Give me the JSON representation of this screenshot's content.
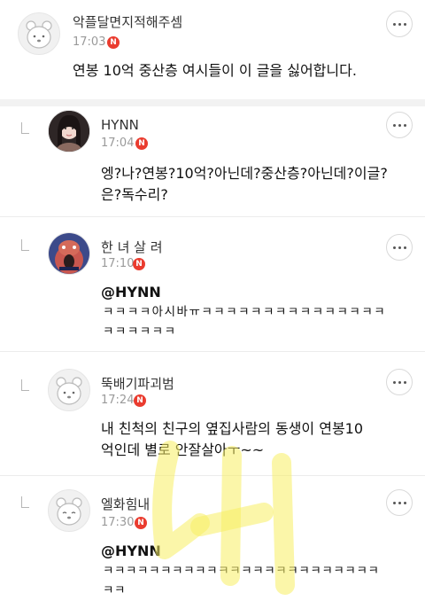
{
  "comments": [
    {
      "author": "악플달면지적해주셈",
      "time": "17:03",
      "badge": "N",
      "avatar_icon": "default-bear-avatar",
      "line1": "연봉 10억 중산층 여시들이 이 글을 싫어합니다.",
      "line2": ""
    },
    {
      "author": "HYNN",
      "time": "17:04",
      "badge": "N",
      "avatar_icon": "profile-photo-avatar",
      "line1": "엥?나?연봉?10억?아닌데?중산층?아닌데?이글?",
      "line2": "은?독수리?"
    },
    {
      "author": "한 녀 살 려",
      "time": "17:10",
      "badge": "N",
      "avatar_icon": "illustration-avatar",
      "mention": "@HYNN",
      "line1": "ㅋㅋㅋㅋ아시바ㅠㅋㅋㅋㅋㅋㅋㅋㅋㅋㅋㅋㅋㅋㅋㅋ",
      "line2": "ㅋㅋㅋㅋㅋㅋ"
    },
    {
      "author": "뚝배기파괴범",
      "time": "17:24",
      "badge": "N",
      "avatar_icon": "default-bear-avatar",
      "line1": "내 친척의 친구의 옆집사람의 동생이 연봉10",
      "line2": "억인데 별로 안잘살아ㅜ~~"
    },
    {
      "author": "엘화힘내",
      "time": "17:30",
      "badge": "N",
      "avatar_icon": "default-bear-avatar",
      "mention": "@HYNN",
      "line1": "ㅋㅋㅋㅋㅋㅋㅋㅋㅋㅋㅋㅋㅋㅋㅋㅋㅋㅋㅋㅋㅋㅋㅋㅋ",
      "line2": "ㅋㅋ"
    }
  ],
  "colors": {
    "badge": "#ea3c2f",
    "watermark": "#f7ef63",
    "separator": "#f2f2f2"
  }
}
